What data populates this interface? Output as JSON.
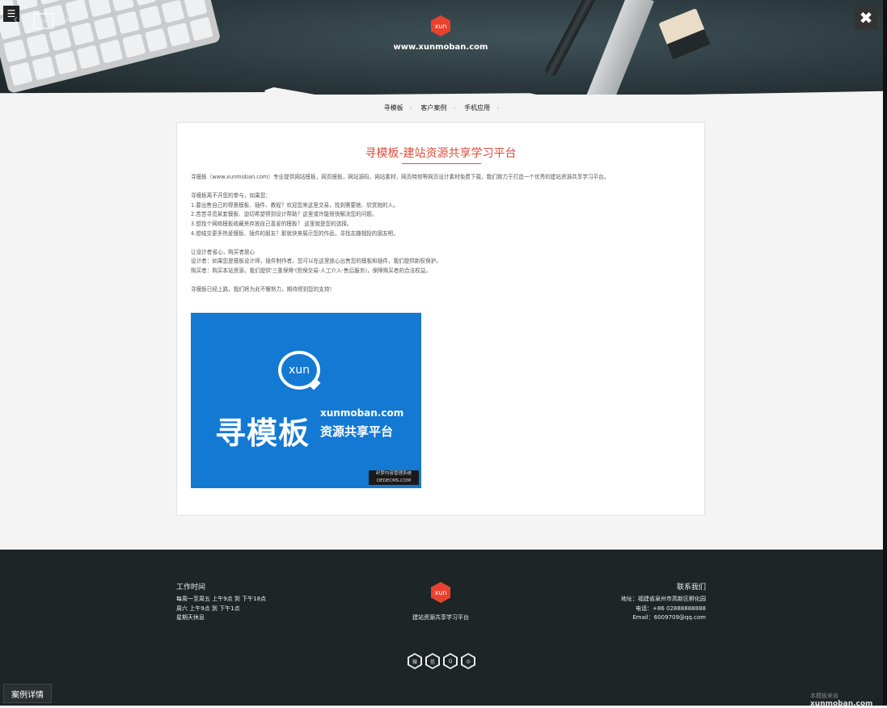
{
  "header": {
    "logo_text": "xun",
    "site_url": "www.xunmoban.com"
  },
  "controls": {
    "menu_icon": "☰",
    "close_icon": "✖",
    "prev_icon": "‹",
    "next_icon": "›"
  },
  "breadcrumb": {
    "items": [
      "寻模板",
      "客户案例",
      "手机应用"
    ]
  },
  "article": {
    "title": "寻模板-建站资源共享学习平台",
    "paragraphs": [
      "寻模板（www.xunmoban.com）专业提供网站模板，网页模板，网站源码，网站素材，网页特效等网页设计素材免费下载，我们致力于打造一个优秀的建站资源共享学习平台。",
      "",
      "寻模板离不开您的参与，如果您：",
      "1.要出售自己的得意模板、插件、教程？欢迎您来这里交易，找到需要她、欣赏她的人。",
      "2.苦苦寻觅某套模板、迫切希望得到设计帮助？这里或许能很快解决您的问题。",
      "3.想找个网络模板收藏夹存放自己喜爱的模板？ 这里就是您的选择。",
      "4.想结交更多热爱模板、插件的朋友？那就快来展示您的作品，寻找志趣相投的朋友吧。",
      "",
      "让设计者省心，购买者放心",
      "设计者：如果您是模板设计师，插件制作者。您可以在这里放心出售您的模板和插件，我们提供新权保护。",
      "购买者：购买本站资源，我们提供'三重保障'(担保交易-人工介入-售后服务)，保障购买者的合法权益。",
      "",
      "寻模板已经上路，我们将为此不懈努力，期待得到您的支持！"
    ]
  },
  "banner": {
    "bubble_text": "xun",
    "title": "寻模板",
    "domain": "xunmoban.com",
    "slogan": "资源共享平台",
    "watermark_line1": "织梦内容管理系统",
    "watermark_line2": "DEDECMS.COM"
  },
  "footer": {
    "work_title": "工作时间",
    "work_hours": [
      "每周一至周五 上午9点 到 下午18点",
      "周六 上午9点 到 下午1点",
      "星期天休息"
    ],
    "logo_text": "xun",
    "slogan": "建站资源共享学习平台",
    "contact_title": "联系我们",
    "contact": [
      "地址：福建省泉州市高新区孵化园",
      "电话：+86 02888888888",
      "Email：6009709@qq.com"
    ],
    "social_icons": [
      "weibo-icon",
      "wechat-icon",
      "qq-icon",
      "dribbble-icon"
    ]
  },
  "case_button": "案例详情",
  "credit": {
    "prefix": "本模板来自",
    "site": "xunmoban.com"
  }
}
